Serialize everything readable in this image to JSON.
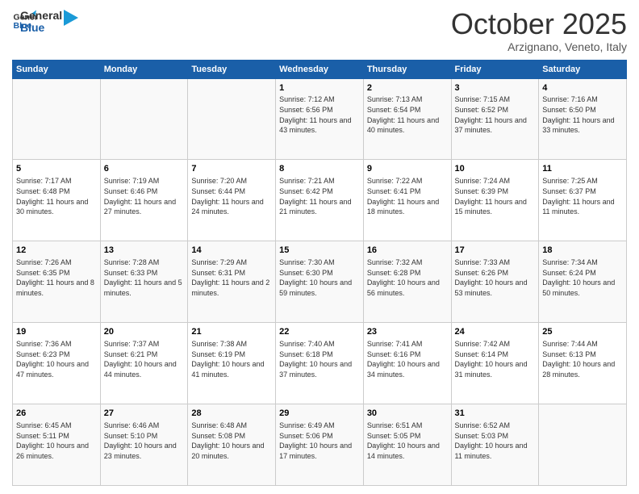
{
  "header": {
    "logo_general": "General",
    "logo_blue": "Blue",
    "month_title": "October 2025",
    "location": "Arzignano, Veneto, Italy"
  },
  "weekdays": [
    "Sunday",
    "Monday",
    "Tuesday",
    "Wednesday",
    "Thursday",
    "Friday",
    "Saturday"
  ],
  "weeks": [
    [
      {
        "day": "",
        "sunrise": "",
        "sunset": "",
        "daylight": ""
      },
      {
        "day": "",
        "sunrise": "",
        "sunset": "",
        "daylight": ""
      },
      {
        "day": "",
        "sunrise": "",
        "sunset": "",
        "daylight": ""
      },
      {
        "day": "1",
        "sunrise": "Sunrise: 7:12 AM",
        "sunset": "Sunset: 6:56 PM",
        "daylight": "Daylight: 11 hours and 43 minutes."
      },
      {
        "day": "2",
        "sunrise": "Sunrise: 7:13 AM",
        "sunset": "Sunset: 6:54 PM",
        "daylight": "Daylight: 11 hours and 40 minutes."
      },
      {
        "day": "3",
        "sunrise": "Sunrise: 7:15 AM",
        "sunset": "Sunset: 6:52 PM",
        "daylight": "Daylight: 11 hours and 37 minutes."
      },
      {
        "day": "4",
        "sunrise": "Sunrise: 7:16 AM",
        "sunset": "Sunset: 6:50 PM",
        "daylight": "Daylight: 11 hours and 33 minutes."
      }
    ],
    [
      {
        "day": "5",
        "sunrise": "Sunrise: 7:17 AM",
        "sunset": "Sunset: 6:48 PM",
        "daylight": "Daylight: 11 hours and 30 minutes."
      },
      {
        "day": "6",
        "sunrise": "Sunrise: 7:19 AM",
        "sunset": "Sunset: 6:46 PM",
        "daylight": "Daylight: 11 hours and 27 minutes."
      },
      {
        "day": "7",
        "sunrise": "Sunrise: 7:20 AM",
        "sunset": "Sunset: 6:44 PM",
        "daylight": "Daylight: 11 hours and 24 minutes."
      },
      {
        "day": "8",
        "sunrise": "Sunrise: 7:21 AM",
        "sunset": "Sunset: 6:42 PM",
        "daylight": "Daylight: 11 hours and 21 minutes."
      },
      {
        "day": "9",
        "sunrise": "Sunrise: 7:22 AM",
        "sunset": "Sunset: 6:41 PM",
        "daylight": "Daylight: 11 hours and 18 minutes."
      },
      {
        "day": "10",
        "sunrise": "Sunrise: 7:24 AM",
        "sunset": "Sunset: 6:39 PM",
        "daylight": "Daylight: 11 hours and 15 minutes."
      },
      {
        "day": "11",
        "sunrise": "Sunrise: 7:25 AM",
        "sunset": "Sunset: 6:37 PM",
        "daylight": "Daylight: 11 hours and 11 minutes."
      }
    ],
    [
      {
        "day": "12",
        "sunrise": "Sunrise: 7:26 AM",
        "sunset": "Sunset: 6:35 PM",
        "daylight": "Daylight: 11 hours and 8 minutes."
      },
      {
        "day": "13",
        "sunrise": "Sunrise: 7:28 AM",
        "sunset": "Sunset: 6:33 PM",
        "daylight": "Daylight: 11 hours and 5 minutes."
      },
      {
        "day": "14",
        "sunrise": "Sunrise: 7:29 AM",
        "sunset": "Sunset: 6:31 PM",
        "daylight": "Daylight: 11 hours and 2 minutes."
      },
      {
        "day": "15",
        "sunrise": "Sunrise: 7:30 AM",
        "sunset": "Sunset: 6:30 PM",
        "daylight": "Daylight: 10 hours and 59 minutes."
      },
      {
        "day": "16",
        "sunrise": "Sunrise: 7:32 AM",
        "sunset": "Sunset: 6:28 PM",
        "daylight": "Daylight: 10 hours and 56 minutes."
      },
      {
        "day": "17",
        "sunrise": "Sunrise: 7:33 AM",
        "sunset": "Sunset: 6:26 PM",
        "daylight": "Daylight: 10 hours and 53 minutes."
      },
      {
        "day": "18",
        "sunrise": "Sunrise: 7:34 AM",
        "sunset": "Sunset: 6:24 PM",
        "daylight": "Daylight: 10 hours and 50 minutes."
      }
    ],
    [
      {
        "day": "19",
        "sunrise": "Sunrise: 7:36 AM",
        "sunset": "Sunset: 6:23 PM",
        "daylight": "Daylight: 10 hours and 47 minutes."
      },
      {
        "day": "20",
        "sunrise": "Sunrise: 7:37 AM",
        "sunset": "Sunset: 6:21 PM",
        "daylight": "Daylight: 10 hours and 44 minutes."
      },
      {
        "day": "21",
        "sunrise": "Sunrise: 7:38 AM",
        "sunset": "Sunset: 6:19 PM",
        "daylight": "Daylight: 10 hours and 41 minutes."
      },
      {
        "day": "22",
        "sunrise": "Sunrise: 7:40 AM",
        "sunset": "Sunset: 6:18 PM",
        "daylight": "Daylight: 10 hours and 37 minutes."
      },
      {
        "day": "23",
        "sunrise": "Sunrise: 7:41 AM",
        "sunset": "Sunset: 6:16 PM",
        "daylight": "Daylight: 10 hours and 34 minutes."
      },
      {
        "day": "24",
        "sunrise": "Sunrise: 7:42 AM",
        "sunset": "Sunset: 6:14 PM",
        "daylight": "Daylight: 10 hours and 31 minutes."
      },
      {
        "day": "25",
        "sunrise": "Sunrise: 7:44 AM",
        "sunset": "Sunset: 6:13 PM",
        "daylight": "Daylight: 10 hours and 28 minutes."
      }
    ],
    [
      {
        "day": "26",
        "sunrise": "Sunrise: 6:45 AM",
        "sunset": "Sunset: 5:11 PM",
        "daylight": "Daylight: 10 hours and 26 minutes."
      },
      {
        "day": "27",
        "sunrise": "Sunrise: 6:46 AM",
        "sunset": "Sunset: 5:10 PM",
        "daylight": "Daylight: 10 hours and 23 minutes."
      },
      {
        "day": "28",
        "sunrise": "Sunrise: 6:48 AM",
        "sunset": "Sunset: 5:08 PM",
        "daylight": "Daylight: 10 hours and 20 minutes."
      },
      {
        "day": "29",
        "sunrise": "Sunrise: 6:49 AM",
        "sunset": "Sunset: 5:06 PM",
        "daylight": "Daylight: 10 hours and 17 minutes."
      },
      {
        "day": "30",
        "sunrise": "Sunrise: 6:51 AM",
        "sunset": "Sunset: 5:05 PM",
        "daylight": "Daylight: 10 hours and 14 minutes."
      },
      {
        "day": "31",
        "sunrise": "Sunrise: 6:52 AM",
        "sunset": "Sunset: 5:03 PM",
        "daylight": "Daylight: 10 hours and 11 minutes."
      },
      {
        "day": "",
        "sunrise": "",
        "sunset": "",
        "daylight": ""
      }
    ]
  ]
}
